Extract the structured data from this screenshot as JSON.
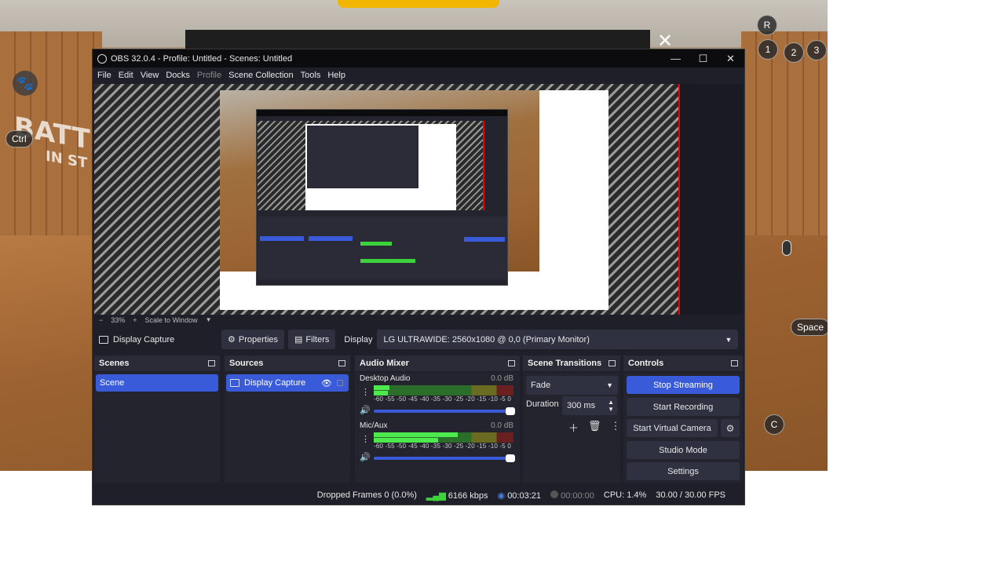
{
  "window": {
    "title": "OBS 32.0.4 - Profile: Untitled - Scenes: Untitled",
    "minimize": "—",
    "maximize": "☐",
    "close": "✕"
  },
  "menu": [
    "File",
    "Edit",
    "View",
    "Docks",
    "Profile",
    "Scene Collection",
    "Tools",
    "Help"
  ],
  "overlay_keys": {
    "ctrl": "Ctrl",
    "r": "R",
    "k1": "1",
    "k2": "2",
    "k3": "3",
    "space": "Space",
    "c": "C"
  },
  "background_text": {
    "line1": "BATT",
    "line2": "IN ST"
  },
  "zoom": {
    "minus": "−",
    "value": "33%",
    "plus": "+",
    "mode": "Scale to Window"
  },
  "source_bar": {
    "selected_source": "Display Capture",
    "properties": "Properties",
    "filters": "Filters",
    "display_label": "Display",
    "display_value": "LG ULTRAWIDE: 2560x1080 @ 0,0 (Primary Monitor)"
  },
  "scenes": {
    "title": "Scenes",
    "items": [
      "Scene"
    ]
  },
  "sources": {
    "title": "Sources",
    "items": [
      "Display Capture"
    ]
  },
  "audio_mixer": {
    "title": "Audio Mixer",
    "scale": "-60 -55 -50 -45 -40 -35 -30 -25 -20 -15 -10 -5 0",
    "channels": [
      {
        "name": "Desktop Audio",
        "db": "0.0 dB",
        "level_top": 0.11,
        "level_bottom": 0.1
      },
      {
        "name": "Mic/Aux",
        "db": "0.0 dB",
        "level_top": 0.6,
        "level_bottom": 0.46
      }
    ]
  },
  "scene_transitions": {
    "title": "Scene Transitions",
    "transition": "Fade",
    "duration_label": "Duration",
    "duration_value": "300 ms"
  },
  "controls": {
    "title": "Controls",
    "stop_streaming": "Stop Streaming",
    "start_recording": "Start Recording",
    "start_virtual_camera": "Start Virtual Camera",
    "studio_mode": "Studio Mode",
    "settings": "Settings"
  },
  "status": {
    "dropped_frames": "Dropped Frames 0 (0.0%)",
    "bitrate": "6166 kbps",
    "stream_time": "00:03:21",
    "record_time": "00:00:00",
    "cpu": "CPU: 1.4%",
    "fps": "30.00 / 30.00 FPS"
  },
  "colors": {
    "accent": "#3a5bd9",
    "window_bg": "#1e1f29",
    "panel_bg": "#23242e",
    "meter_green": "#4cea4c"
  }
}
